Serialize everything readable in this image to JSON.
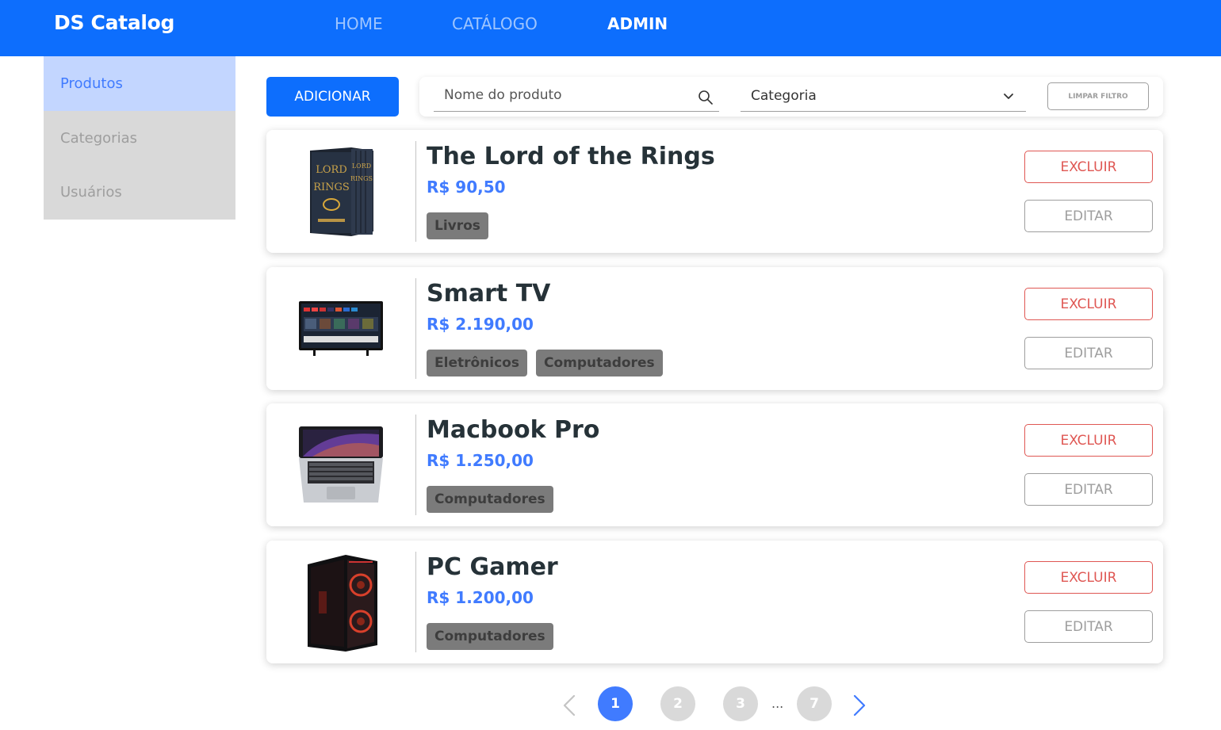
{
  "navbar": {
    "brand": "DS Catalog",
    "links": [
      {
        "label": "HOME",
        "active": false
      },
      {
        "label": "CATÁLOGO",
        "active": false
      },
      {
        "label": "ADMIN",
        "active": true
      }
    ],
    "color": "#0d6efd"
  },
  "sidebar": {
    "items": [
      {
        "label": "Produtos",
        "active": true
      },
      {
        "label": "Categorias",
        "active": false
      },
      {
        "label": "Usuários",
        "active": false
      }
    ]
  },
  "toolbar": {
    "add_label": "ADICIONAR",
    "search_placeholder": "Nome do produto",
    "category_label": "Categoria",
    "clear_label": "LIMPAR FILTRO"
  },
  "products": [
    {
      "name": "The Lord of the Rings",
      "price": "R$ 90,50",
      "categories": [
        "Livros"
      ],
      "image_icon": "book-boxset-icon",
      "delete_label": "EXCLUIR",
      "edit_label": "EDITAR"
    },
    {
      "name": "Smart TV",
      "price": "R$ 2.190,00",
      "categories": [
        "Eletrônicos",
        "Computadores"
      ],
      "image_icon": "tv-icon",
      "delete_label": "EXCLUIR",
      "edit_label": "EDITAR"
    },
    {
      "name": "Macbook Pro",
      "price": "R$ 1.250,00",
      "categories": [
        "Computadores"
      ],
      "image_icon": "laptop-icon",
      "delete_label": "EXCLUIR",
      "edit_label": "EDITAR"
    },
    {
      "name": "PC Gamer",
      "price": "R$ 1.200,00",
      "categories": [
        "Computadores"
      ],
      "image_icon": "pc-tower-icon",
      "delete_label": "EXCLUIR",
      "edit_label": "EDITAR"
    }
  ],
  "pagination": {
    "pages": [
      "1",
      "2",
      "3",
      "7"
    ],
    "current": "1",
    "ellipsis": "..."
  },
  "colors": {
    "primary": "#0d6efd",
    "price": "#407bff",
    "danger": "#df5753",
    "muted": "#9e9e9e",
    "badge": "#7b7b7b"
  }
}
